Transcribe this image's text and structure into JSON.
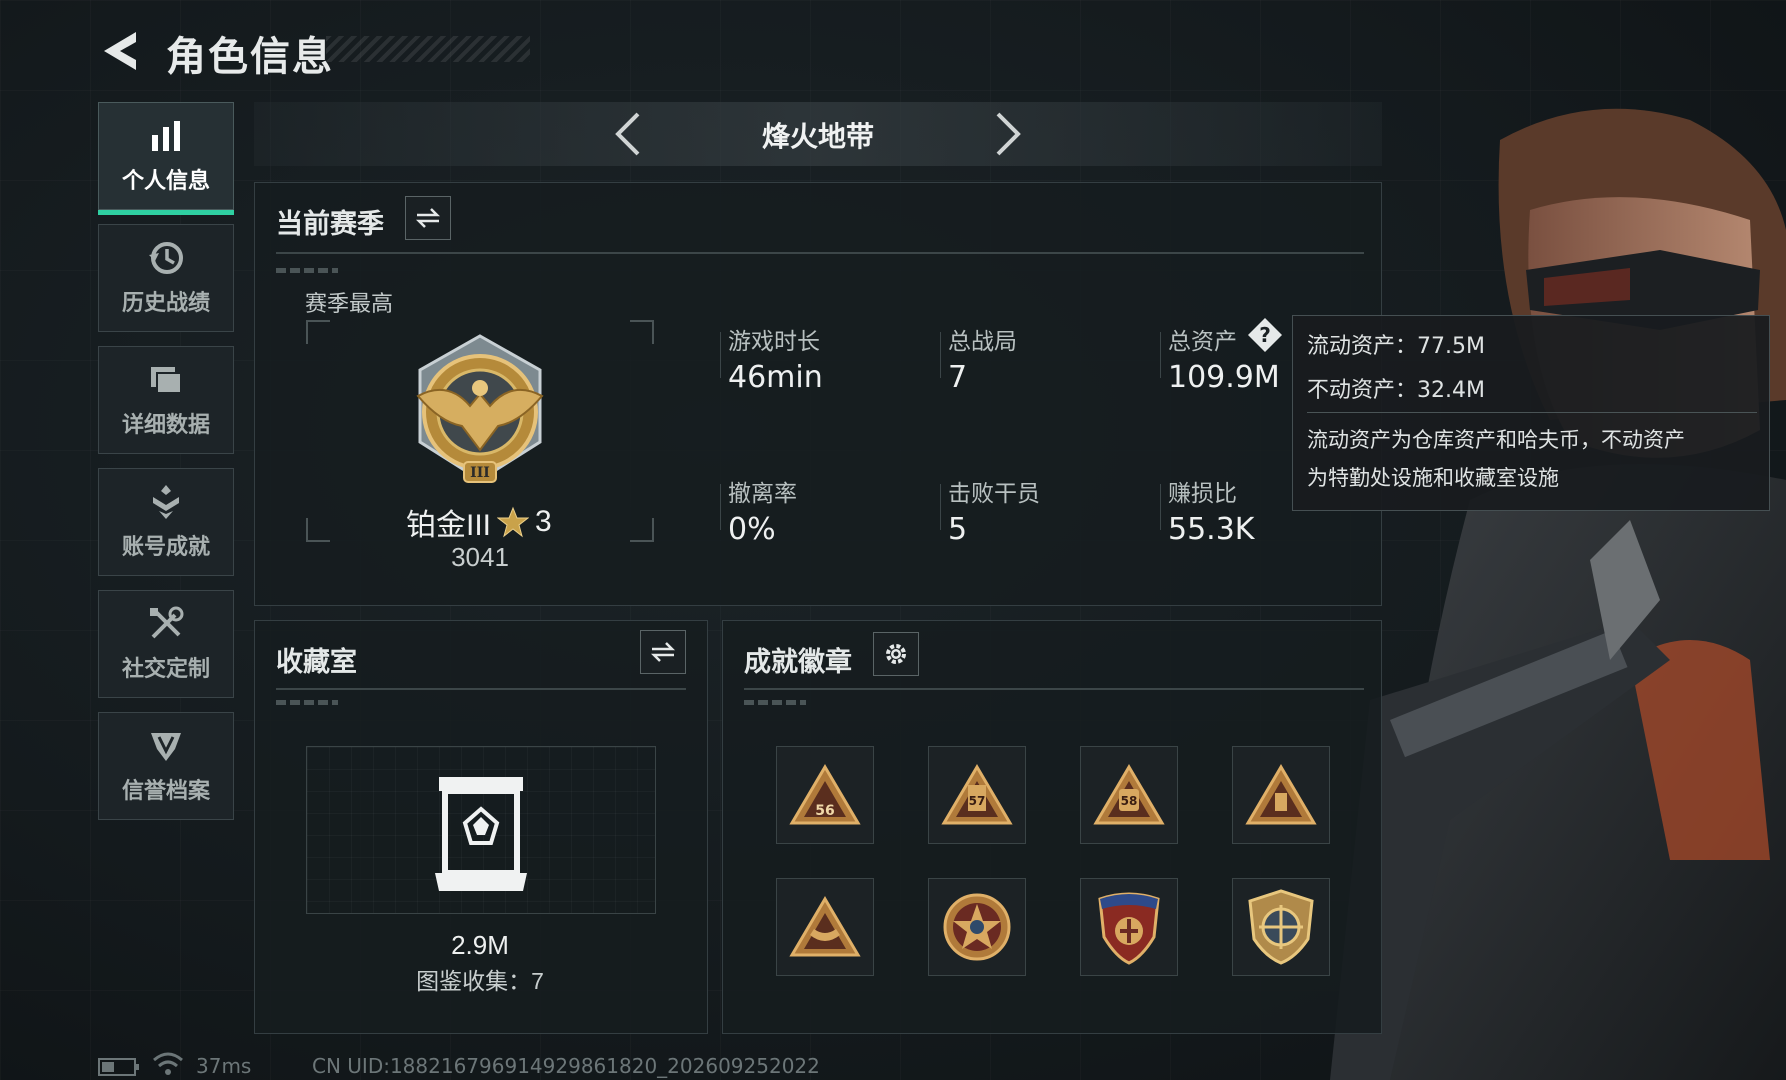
{
  "header": {
    "title": "角色信息",
    "back_icon": "back-arrow-icon"
  },
  "sidebar": {
    "items": [
      {
        "label": "个人信息",
        "icon": "bar-chart-icon",
        "active": true
      },
      {
        "label": "历史战绩",
        "icon": "history-clock-icon",
        "active": false
      },
      {
        "label": "详细数据",
        "icon": "cards-icon",
        "active": false
      },
      {
        "label": "账号成就",
        "icon": "achievement-icon",
        "active": false
      },
      {
        "label": "社交定制",
        "icon": "tools-icon",
        "active": false
      },
      {
        "label": "信誉档案",
        "icon": "shield-icon",
        "active": false
      }
    ]
  },
  "mode": {
    "title": "烽火地带"
  },
  "season": {
    "title": "当前赛季",
    "best_label": "赛季最高",
    "rank_name": "铂金III",
    "rank_stars": "3",
    "rank_score": "3041",
    "stats": [
      {
        "label": "游戏时长",
        "value": "46min"
      },
      {
        "label": "总战局",
        "value": "7"
      },
      {
        "label": "总资产",
        "value": "109.9M"
      },
      {
        "label": "撤离率",
        "value": "0%"
      },
      {
        "label": "击败干员",
        "value": "5"
      },
      {
        "label": "赚损比",
        "value": "55.3K"
      }
    ]
  },
  "tooltip": {
    "liquid": "流动资产：77.5M",
    "fixed": "不动资产：32.4M",
    "desc_line1": "流动资产为仓库资产和哈夫币，不动资产",
    "desc_line2": "为特勤处设施和收藏室设施"
  },
  "collection": {
    "title": "收藏室",
    "value": "2.9M",
    "count_text": "图鉴收集：7"
  },
  "badges": {
    "title": "成就徽章",
    "items": [
      {
        "name": "badge-56",
        "number": "56"
      },
      {
        "name": "badge-57",
        "number": "57"
      },
      {
        "name": "badge-58",
        "number": "58"
      },
      {
        "name": "badge-triangle",
        "number": ""
      },
      {
        "name": "badge-boat",
        "number": ""
      },
      {
        "name": "badge-star-emblem",
        "number": ""
      },
      {
        "name": "badge-shield-stars",
        "number": ""
      },
      {
        "name": "badge-crosshair-shield",
        "number": ""
      }
    ]
  },
  "status": {
    "ping": "37ms",
    "uid": "CN UID:18821679691492986182​0_202609252022"
  },
  "colors": {
    "accent": "#2fd0a2",
    "gold": "#c9a24a",
    "bronze": "#b07a3a"
  }
}
